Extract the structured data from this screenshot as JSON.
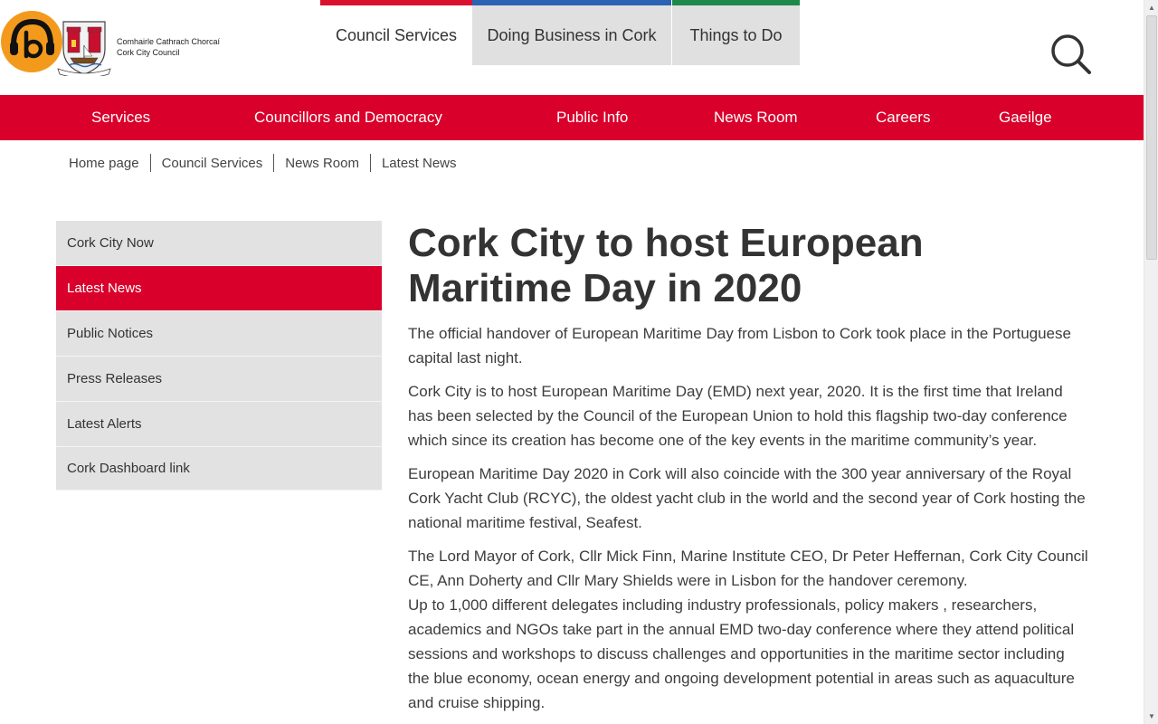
{
  "header": {
    "logo": {
      "line1": "Comhairle Cathrach Chorcaí",
      "line2": "Cork City Council"
    },
    "top_tabs": [
      {
        "label": "Council Services",
        "color": "#d9112e"
      },
      {
        "label": "Doing Business in Cork",
        "color": "#2a62b4"
      },
      {
        "label": "Things to Do",
        "color": "#1e8a4a"
      }
    ],
    "search_icon": "search-icon",
    "accessibility_icon": "headphones-b-icon"
  },
  "main_nav": {
    "color": "#d9002b",
    "items": [
      "Services",
      "Councillors and Democracy",
      "Public Info",
      "News Room",
      "Careers",
      "Gaeilge"
    ]
  },
  "breadcrumb": [
    "Home page",
    "Council Services",
    "News Room",
    "Latest News"
  ],
  "side_menu": {
    "items": [
      "Cork City Now",
      "Latest News",
      "Public Notices",
      "Press Releases",
      "Latest Alerts",
      "Cork Dashboard link"
    ],
    "active": "Latest News"
  },
  "article": {
    "title": "Cork City to host European Maritime Day in 2020",
    "paragraphs": [
      "The official handover of European Maritime Day from Lisbon to Cork took place in the Portuguese capital last night.",
      "Cork City is to host European Maritime Day (EMD) next year, 2020. It is the first time that Ireland has been selected by the Council of the European Union to hold this flagship two-day conference which since its creation has become one of the key events in the maritime community’s year.",
      "European Maritime Day 2020 in Cork will also coincide with the 300 year anniversary of the Royal Cork Yacht Club (RCYC), the oldest yacht club in the world and the second year of Cork hosting the national maritime festival, Seafest.",
      "The Lord Mayor of Cork, Cllr Mick Finn, Marine Institute CEO, Dr Peter Heffernan, Cork City Council CE, Ann Doherty and Cllr Mary Shields were in Lisbon for the handover ceremony.",
      "Up to 1,000 different  delegates including  industry professionals, policy makers , researchers, academics and NGOs take part in the annual EMD two-day conference  where they attend political sessions and workshops to discuss challenges and opportunities in the maritime sector including the blue economy, ocean energy and ongoing development potential in areas such as aquaculture and cruise shipping."
    ]
  }
}
